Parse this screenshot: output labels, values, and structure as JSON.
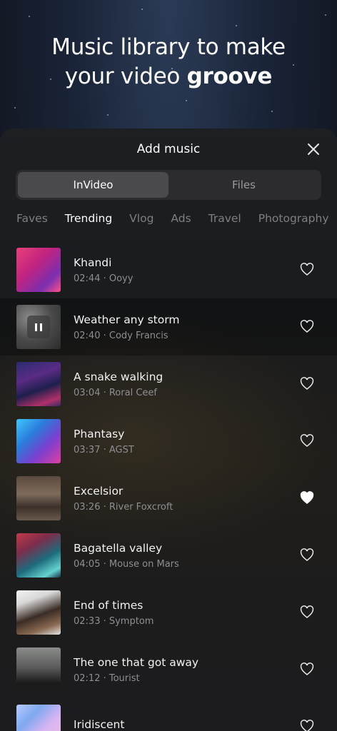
{
  "hero": {
    "line1": "Music library to make",
    "line2_prefix": "your video",
    "line2_bold": "groove"
  },
  "sheet": {
    "title": "Add music",
    "close_icon": "close-icon"
  },
  "segments": [
    {
      "label": "InVideo",
      "active": true
    },
    {
      "label": "Files",
      "active": false
    }
  ],
  "categories": [
    {
      "label": "Faves",
      "active": false
    },
    {
      "label": "Trending",
      "active": true
    },
    {
      "label": "Vlog",
      "active": false
    },
    {
      "label": "Ads",
      "active": false
    },
    {
      "label": "Travel",
      "active": false
    },
    {
      "label": "Photography",
      "active": false
    }
  ],
  "tracks": [
    {
      "title": "Khandi",
      "duration": "02:44",
      "artist": "Ooyy",
      "sub": "02:44 · Ooyy",
      "favorite": false,
      "playing": false
    },
    {
      "title": "Weather any storm",
      "duration": "02:40",
      "artist": "Cody Francis",
      "sub": "02:40 · Cody Francis",
      "favorite": false,
      "playing": true
    },
    {
      "title": "A snake walking",
      "duration": "03:04",
      "artist": "Roral Ceef",
      "sub": "03:04 · Roral Ceef",
      "favorite": false,
      "playing": false
    },
    {
      "title": "Phantasy",
      "duration": "03:37",
      "artist": "AGST",
      "sub": "03:37 · AGST",
      "favorite": false,
      "playing": false
    },
    {
      "title": "Excelsior",
      "duration": "03:26",
      "artist": "River Foxcroft",
      "sub": "03:26 · River Foxcroft",
      "favorite": true,
      "playing": false
    },
    {
      "title": "Bagatella valley",
      "duration": "04:05",
      "artist": "Mouse on Mars",
      "sub": "04:05 · Mouse on Mars",
      "favorite": false,
      "playing": false
    },
    {
      "title": "End of times",
      "duration": "02:33",
      "artist": "Symptom",
      "sub": "02:33 · Symptom",
      "favorite": false,
      "playing": false
    },
    {
      "title": "The one that got away",
      "duration": "02:12",
      "artist": "Tourist",
      "sub": "02:12 · Tourist",
      "favorite": false,
      "playing": false
    },
    {
      "title": "Iridiscent",
      "duration": "",
      "artist": "",
      "sub": "",
      "favorite": false,
      "playing": false
    }
  ]
}
